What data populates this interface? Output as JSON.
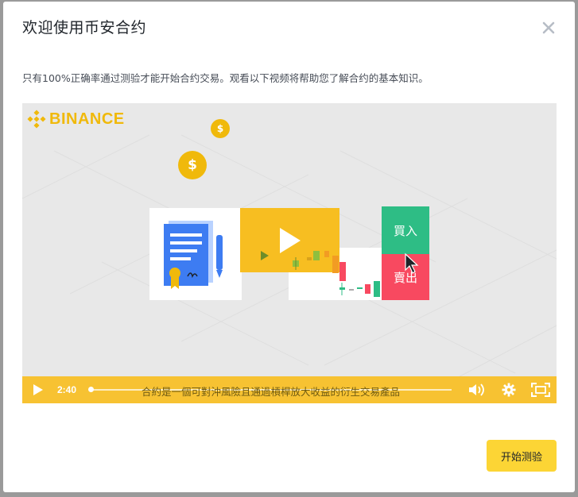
{
  "modal": {
    "title": "欢迎使用币安合约",
    "description": "只有100%正确率通过测验才能开始合约交易。观看以下视频将帮助您了解合约的基本知识。",
    "start_button_label": "开始测验"
  },
  "video": {
    "brand_text": "BINANCE",
    "buy_label": "買入",
    "sell_label": "賣出",
    "current_time": "2:40",
    "subtitle": "合約是一個可對沖風險且通過槓桿放大收益的衍生交易產品",
    "progress": 0.0
  },
  "icons": {
    "close": "close-icon",
    "play": "play-icon",
    "volume": "volume-icon",
    "settings": "gear-icon",
    "fullscreen": "fullscreen-icon",
    "coin": "dollar-coin-icon",
    "cursor": "mouse-cursor-icon"
  },
  "colors": {
    "accent": "#fcd535",
    "brand": "#f0b90b",
    "buy": "#2ebd85",
    "sell": "#f84960",
    "control_bar": "#f7c232"
  }
}
